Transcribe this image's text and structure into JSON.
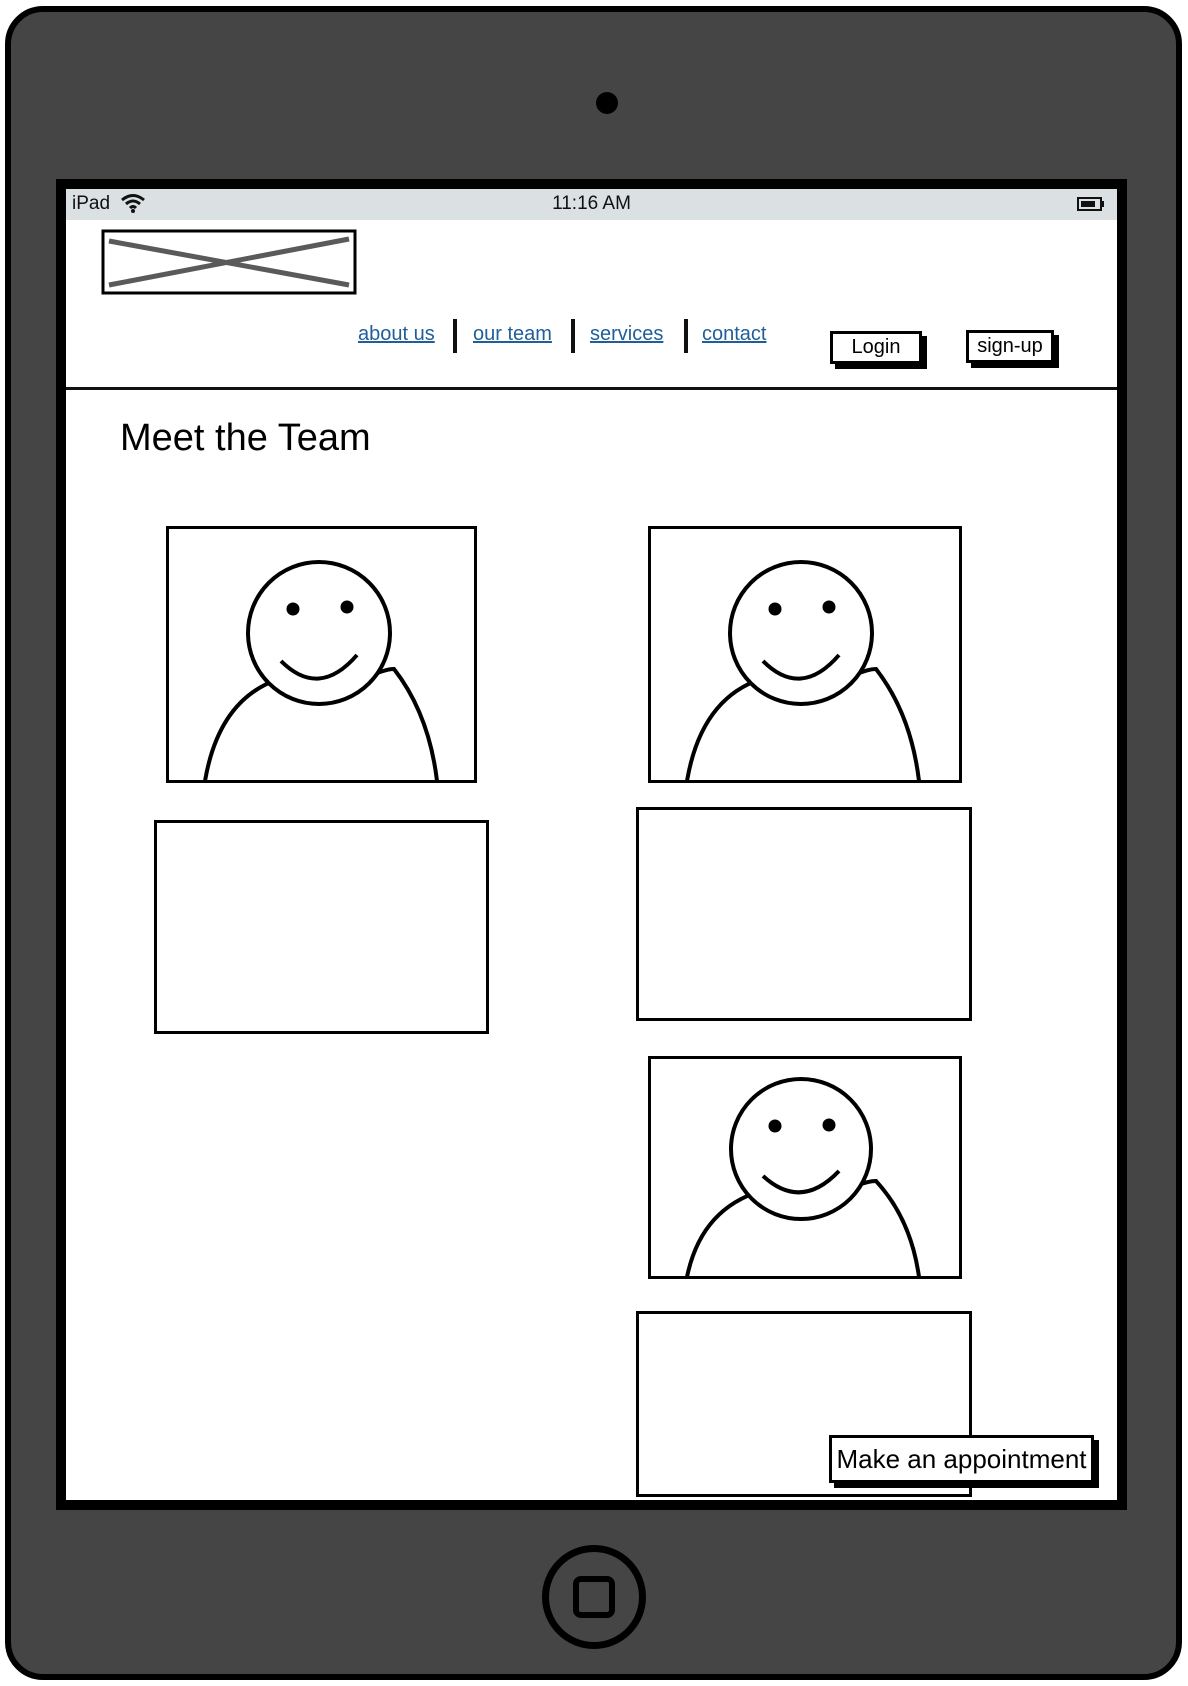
{
  "status_bar": {
    "device_name": "iPad",
    "time": "11:16 AM",
    "wifi_icon": "wifi-icon",
    "battery_icon": "battery-icon"
  },
  "logo": {
    "icon": "image-placeholder-icon"
  },
  "nav": {
    "links": [
      "about us",
      "our team",
      "services",
      "contact"
    ],
    "login_label": "Login",
    "signup_label": "sign-up",
    "link_color": "#1f5e99"
  },
  "main": {
    "title": "Meet the Team",
    "team_members": [
      {
        "photo_icon": "person-avatar-icon"
      },
      {
        "photo_icon": "person-avatar-icon"
      },
      {
        "photo_icon": "person-avatar-icon"
      }
    ]
  },
  "cta": {
    "label": "Make an appointment"
  },
  "colors": {
    "device_body": "#454545",
    "status_bar": "#dbe0e3"
  }
}
